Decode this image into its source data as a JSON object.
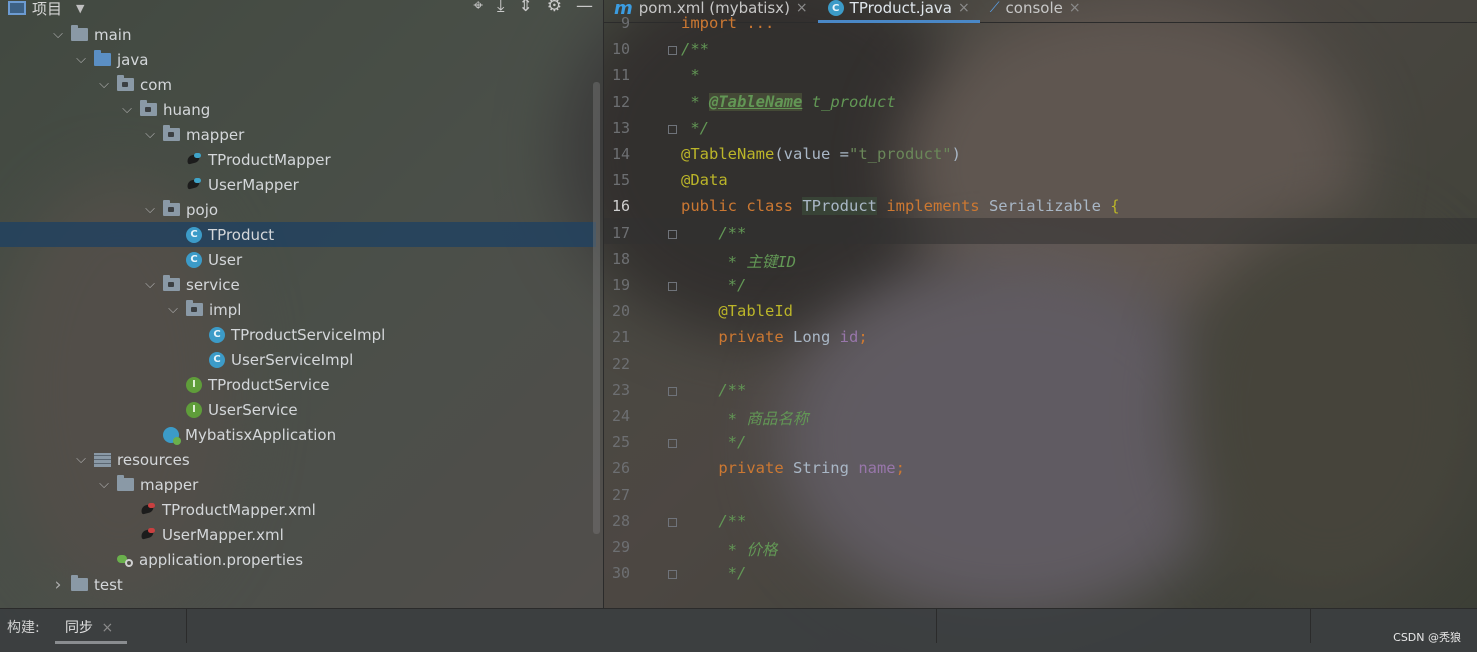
{
  "project_panel": {
    "title": "项目",
    "tree": [
      {
        "label": "main",
        "indent": 1,
        "expanded": true,
        "icon": "folder-icon"
      },
      {
        "label": "java",
        "indent": 2,
        "expanded": true,
        "icon": "source-folder-icon"
      },
      {
        "label": "com",
        "indent": 3,
        "expanded": true,
        "icon": "package-icon"
      },
      {
        "label": "huang",
        "indent": 4,
        "expanded": true,
        "icon": "package-icon"
      },
      {
        "label": "mapper",
        "indent": 5,
        "expanded": true,
        "icon": "package-icon"
      },
      {
        "label": "TProductMapper",
        "indent": 6,
        "icon": "mybatis-mapper-icon"
      },
      {
        "label": "UserMapper",
        "indent": 6,
        "icon": "mybatis-mapper-icon"
      },
      {
        "label": "pojo",
        "indent": 5,
        "expanded": true,
        "icon": "package-icon"
      },
      {
        "label": "TProduct",
        "indent": 6,
        "icon": "class-icon",
        "selected": true
      },
      {
        "label": "User",
        "indent": 6,
        "icon": "class-icon"
      },
      {
        "label": "service",
        "indent": 5,
        "expanded": true,
        "icon": "package-icon"
      },
      {
        "label": "impl",
        "indent": 6,
        "expanded": true,
        "icon": "package-icon"
      },
      {
        "label": "TProductServiceImpl",
        "indent": 7,
        "icon": "class-icon"
      },
      {
        "label": "UserServiceImpl",
        "indent": 7,
        "icon": "class-icon"
      },
      {
        "label": "TProductService",
        "indent": 6,
        "icon": "interface-icon"
      },
      {
        "label": "UserService",
        "indent": 6,
        "icon": "interface-icon"
      },
      {
        "label": "MybatisxApplication",
        "indent": 5,
        "icon": "spring-boot-class-icon"
      },
      {
        "label": "resources",
        "indent": 2,
        "expanded": true,
        "icon": "resources-folder-icon"
      },
      {
        "label": "mapper",
        "indent": 3,
        "expanded": true,
        "icon": "folder-icon"
      },
      {
        "label": "TProductMapper.xml",
        "indent": 4,
        "icon": "mybatis-xml-icon"
      },
      {
        "label": "UserMapper.xml",
        "indent": 4,
        "icon": "mybatis-xml-icon"
      },
      {
        "label": "application.properties",
        "indent": 3,
        "icon": "properties-icon"
      },
      {
        "label": "test",
        "indent": 1,
        "expanded": false,
        "icon": "folder-icon"
      }
    ]
  },
  "tabs": [
    {
      "label": "pom.xml (mybatisx)",
      "icon": "maven-icon",
      "active": false
    },
    {
      "label": "TProduct.java",
      "icon": "class-icon",
      "active": true
    },
    {
      "label": "console",
      "icon": "console-icon",
      "active": false
    }
  ],
  "editor": {
    "current_line": "16",
    "lines": [
      {
        "n": "9",
        "tokens": [
          {
            "t": "import ...",
            "c": "c-kw"
          }
        ]
      },
      {
        "n": "10",
        "tokens": [
          {
            "t": "/**",
            "c": "c-doc"
          }
        ]
      },
      {
        "n": "11",
        "tokens": [
          {
            "t": " *",
            "c": "c-doc"
          }
        ]
      },
      {
        "n": "12",
        "tokens": [
          {
            "t": " * ",
            "c": "c-doc"
          },
          {
            "t": "@TableName",
            "c": "c-tag"
          },
          {
            "t": " t_product",
            "c": "c-doc"
          }
        ]
      },
      {
        "n": "13",
        "tokens": [
          {
            "t": " */",
            "c": "c-doc"
          }
        ]
      },
      {
        "n": "14",
        "tokens": [
          {
            "t": "@TableName",
            "c": "c-ann"
          },
          {
            "t": "(value =",
            "c": "c-id"
          },
          {
            "t": "\"t_product\"",
            "c": "c-str"
          },
          {
            "t": ")",
            "c": "c-id"
          }
        ]
      },
      {
        "n": "15",
        "tokens": [
          {
            "t": "@Data",
            "c": "c-ann"
          }
        ]
      },
      {
        "n": "16",
        "tokens": [
          {
            "t": "public class ",
            "c": "c-kw"
          },
          {
            "t": "TProduct",
            "c": "c-cls"
          },
          {
            "t": " implements ",
            "c": "c-kw"
          },
          {
            "t": "Serializable ",
            "c": "c-id"
          },
          {
            "t": "{",
            "c": "c-ann"
          }
        ]
      },
      {
        "n": "17",
        "tokens": [
          {
            "t": "    /**",
            "c": "c-doc"
          }
        ]
      },
      {
        "n": "18",
        "tokens": [
          {
            "t": "     * 主键ID",
            "c": "c-doc"
          }
        ]
      },
      {
        "n": "19",
        "tokens": [
          {
            "t": "     */",
            "c": "c-doc"
          }
        ]
      },
      {
        "n": "20",
        "tokens": [
          {
            "t": "    @TableId",
            "c": "c-ann"
          }
        ]
      },
      {
        "n": "21",
        "tokens": [
          {
            "t": "    private ",
            "c": "c-kw"
          },
          {
            "t": "Long ",
            "c": "c-id"
          },
          {
            "t": "id",
            "c": "c-field"
          },
          {
            "t": ";",
            "c": "c-kw"
          }
        ]
      },
      {
        "n": "22",
        "tokens": []
      },
      {
        "n": "23",
        "tokens": [
          {
            "t": "    /**",
            "c": "c-doc"
          }
        ]
      },
      {
        "n": "24",
        "tokens": [
          {
            "t": "     * 商品名称",
            "c": "c-doc"
          }
        ]
      },
      {
        "n": "25",
        "tokens": [
          {
            "t": "     */",
            "c": "c-doc"
          }
        ]
      },
      {
        "n": "26",
        "tokens": [
          {
            "t": "    private ",
            "c": "c-kw"
          },
          {
            "t": "String ",
            "c": "c-id"
          },
          {
            "t": "name",
            "c": "c-field"
          },
          {
            "t": ";",
            "c": "c-kw"
          }
        ]
      },
      {
        "n": "27",
        "tokens": []
      },
      {
        "n": "28",
        "tokens": [
          {
            "t": "    /**",
            "c": "c-doc"
          }
        ]
      },
      {
        "n": "29",
        "tokens": [
          {
            "t": "     * 价格",
            "c": "c-doc"
          }
        ]
      },
      {
        "n": "30",
        "tokens": [
          {
            "t": "     */",
            "c": "c-doc"
          }
        ]
      }
    ]
  },
  "bottom_bar": {
    "build_label": "构建:",
    "sync_tab": "同步",
    "close_glyph": "×",
    "watermark": "CSDN @秃狼"
  }
}
